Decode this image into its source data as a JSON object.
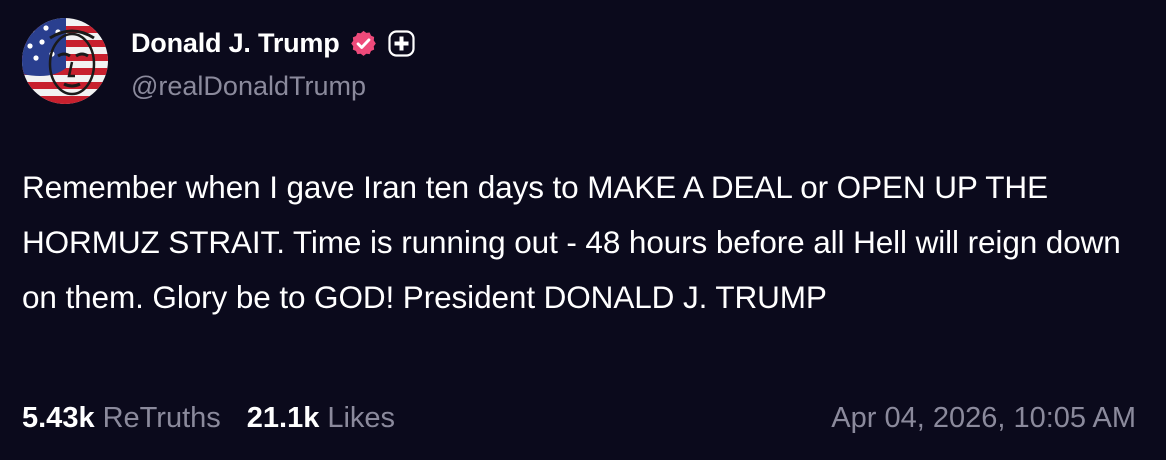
{
  "author": {
    "display_name": "Donald J. Trump",
    "handle": "@realDonaldTrump",
    "avatar_icon": "flag-portrait-avatar",
    "verified_icon": "verified-badge-icon",
    "verified_color": "#ee4a7a",
    "badge_icon": "plus-badge-icon"
  },
  "post": {
    "text": "Remember when I gave Iran ten days to MAKE A DEAL or OPEN UP THE HORMUZ STRAIT. Time is running out - 48 hours before all Hell will reign down on them. Glory be to GOD! President DONALD J. TRUMP"
  },
  "stats": {
    "retruths_count": "5.43k",
    "retruths_label": "ReTruths",
    "likes_count": "21.1k",
    "likes_label": "Likes"
  },
  "timestamp": "Apr 04, 2026, 10:05 AM",
  "colors": {
    "background": "#0b0a1c",
    "text_primary": "#ffffff",
    "text_secondary": "#8b8a9c"
  }
}
